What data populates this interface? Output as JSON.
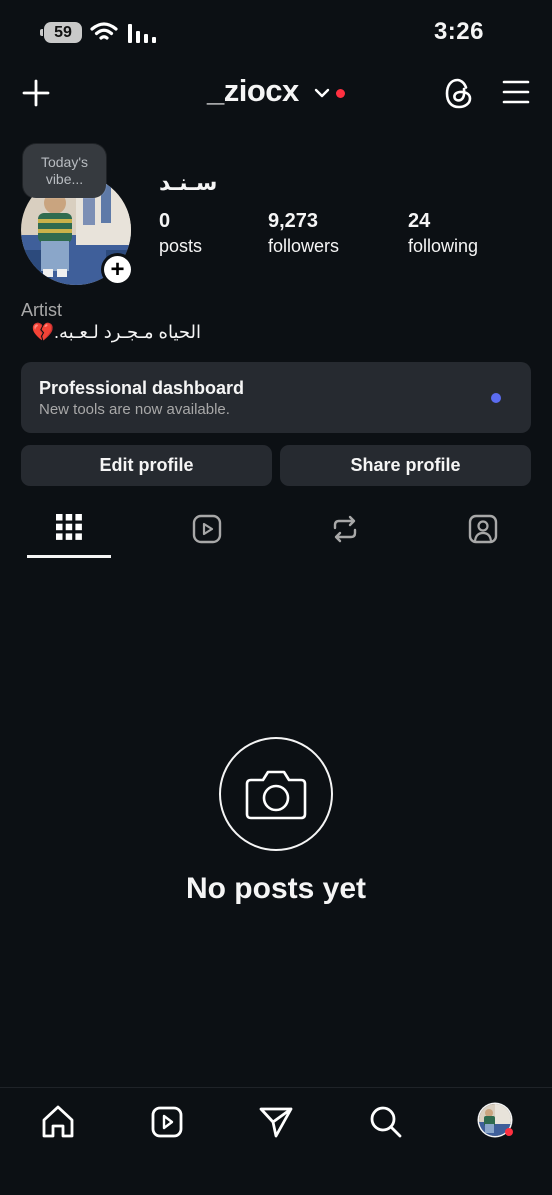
{
  "status_bar": {
    "battery": "59",
    "time": "3:26"
  },
  "header": {
    "username": "_ziocx",
    "icons": [
      "plus-icon",
      "chevron-down-icon",
      "threads-icon",
      "menu-icon"
    ]
  },
  "profile": {
    "story_note": "Today's vibe...",
    "display_name": "سـنـد",
    "stats": [
      {
        "value": "0",
        "label": "posts"
      },
      {
        "value": "9,273",
        "label": "followers"
      },
      {
        "value": "24",
        "label": "following"
      }
    ],
    "bio_category": "Artist",
    "bio_text": "الحياه مـجـرد لـعـبه.💔"
  },
  "dashboard": {
    "title": "Professional dashboard",
    "subtitle": "New tools are now available."
  },
  "buttons": {
    "edit": "Edit profile",
    "share": "Share profile"
  },
  "tabs": [
    "grid-icon",
    "reels-icon",
    "reposts-icon",
    "tagged-icon"
  ],
  "empty_state": {
    "text": "No posts yet"
  },
  "bottom_nav": [
    "home-icon",
    "reels-icon",
    "send-icon",
    "search-icon",
    "profile-avatar"
  ],
  "colors": {
    "background": "#0c1014",
    "surface": "#262a30",
    "live_dot": "#ff3040",
    "dashboard_dot": "#5b6cf0",
    "nav_dot": "#ff3040"
  }
}
